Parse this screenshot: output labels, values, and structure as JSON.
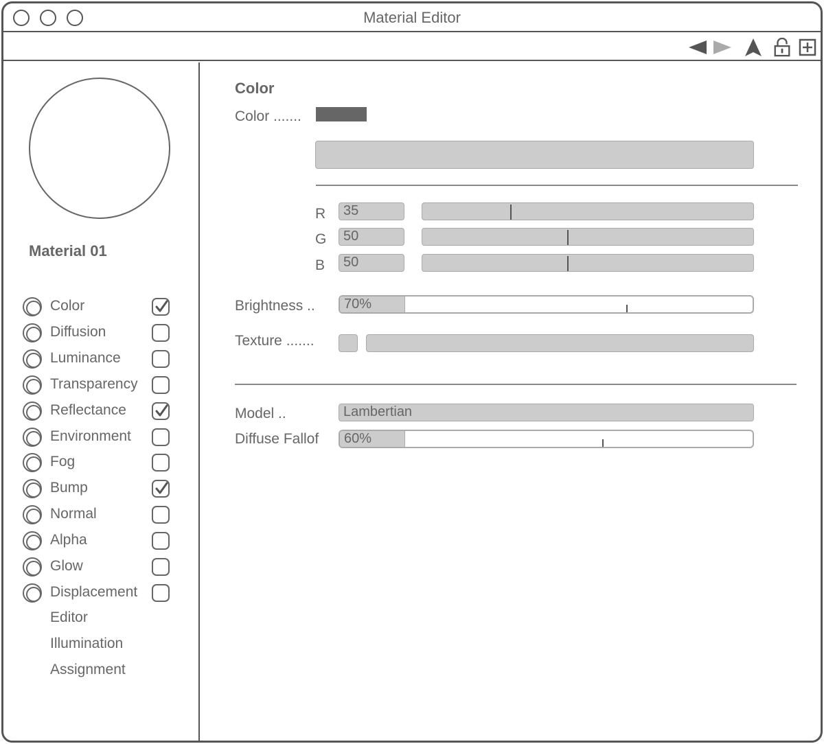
{
  "window": {
    "title": "Material Editor"
  },
  "toolbar": {
    "icons": [
      "arrow-left-icon",
      "arrow-right-icon",
      "navigate-up-icon",
      "lock-open-icon",
      "new-window-icon"
    ]
  },
  "sidebar": {
    "material_name": "Material 01",
    "channels": [
      {
        "label": "Color",
        "checked": true
      },
      {
        "label": "Diffusion",
        "checked": false
      },
      {
        "label": "Luminance",
        "checked": false
      },
      {
        "label": "Transparency",
        "checked": false
      },
      {
        "label": "Reflectance",
        "checked": true
      },
      {
        "label": "Environment",
        "checked": false
      },
      {
        "label": "Fog",
        "checked": false
      },
      {
        "label": "Bump",
        "checked": true
      },
      {
        "label": "Normal",
        "checked": false
      },
      {
        "label": "Alpha",
        "checked": false
      },
      {
        "label": "Glow",
        "checked": false
      },
      {
        "label": "Displacement",
        "checked": false
      }
    ],
    "extras": [
      "Editor",
      "Illumination",
      "Assignment"
    ]
  },
  "main": {
    "section_title": "Color",
    "color_label": "Color .......",
    "color_swatch": "#666666",
    "rgb": [
      {
        "label": "R",
        "value": "35"
      },
      {
        "label": "G",
        "value": "50"
      },
      {
        "label": "B",
        "value": "50"
      }
    ],
    "brightness_label": "Brightness ..",
    "brightness_value": "70%",
    "texture_label": "Texture .......",
    "model_label": "Model ..",
    "model_value": "Lambertian",
    "falloff_label": "Diffuse Fallof",
    "falloff_value": "60%"
  }
}
